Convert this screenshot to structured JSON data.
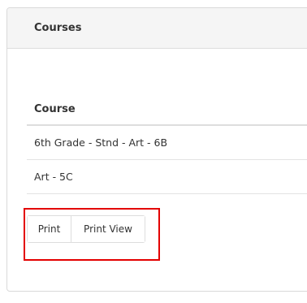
{
  "panel": {
    "title": "Courses"
  },
  "table": {
    "header": "Course",
    "rows": [
      "6th Grade - Stnd - Art - 6B",
      "Art - 5C"
    ]
  },
  "buttons": {
    "print": "Print",
    "print_view": "Print View"
  },
  "colors": {
    "highlight": "#e30000",
    "heading_bg": "#f5f5f5",
    "border": "#dddddd"
  }
}
